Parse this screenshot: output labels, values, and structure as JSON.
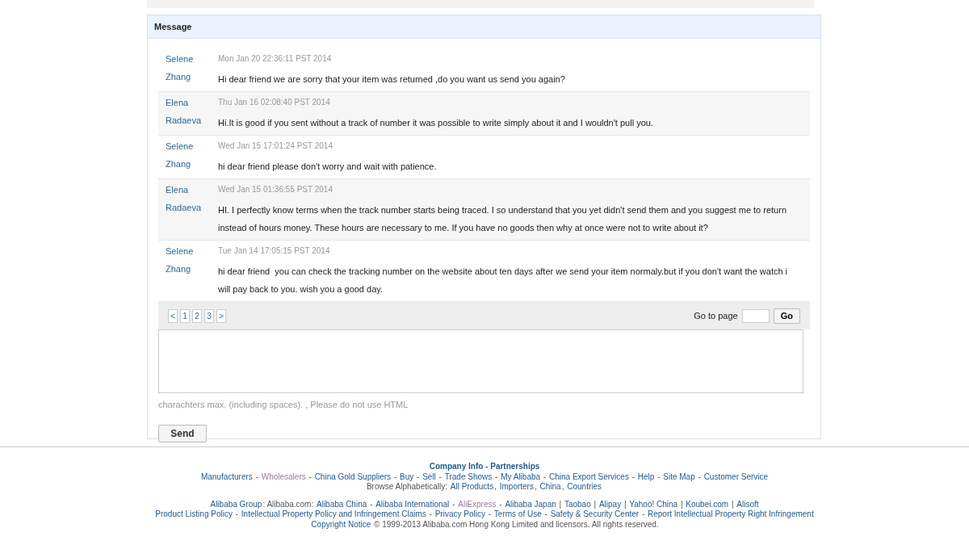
{
  "panel": {
    "title": "Message"
  },
  "messages": [
    {
      "sender": [
        "Selene",
        "Zhang"
      ],
      "time": "Mon Jan 20 22:36:11 PST 2014",
      "text": "Hi dear friend we are sorry that your item was returned ,do you want us send you again?"
    },
    {
      "sender": [
        "Elena",
        "Radaeva"
      ],
      "time": "Thu Jan 16 02:08:40 PST 2014",
      "text": "Hi.It is good if you sent without a track of number it was possible to write simply about it and I wouldn't pull you."
    },
    {
      "sender": [
        "Selene",
        "Zhang"
      ],
      "time": "Wed Jan 15 17:01:24 PST 2014",
      "text": "hi dear friend please don't worry and wait with patience."
    },
    {
      "sender": [
        "Elena",
        "Radaeva"
      ],
      "time": "Wed Jan 15 01:36:55 PST 2014",
      "text": "HI. I perfectly know terms when the track number starts being traced. I so understand that you yet didn't send them and you suggest me to return instead of hours money. These hours are necessary to me. If you have no goods then why at once were not to write about it?"
    },
    {
      "sender": [
        "Selene",
        "Zhang"
      ],
      "time": "Tue Jan 14 17:05:15 PST 2014",
      "text": "hi dear friend  you can check the tracking number on the website about ten days after we send your item normaly.but if you don't want the watch i will pay back to you. wish you a good day."
    }
  ],
  "pager": {
    "pages": [
      "<",
      "1",
      "2",
      "3",
      ">"
    ],
    "goto_label": "Go to page",
    "go_button": "Go"
  },
  "reply": {
    "hint": "charachters max. (including spaces). , Please do not use HTML",
    "send_button": "Send"
  },
  "footer": {
    "lines": [
      [
        {
          "kind": "heading",
          "text": "Company Info - Partnerships"
        }
      ],
      [
        {
          "kind": "link",
          "text": "Manufacturers",
          "visited": false
        },
        {
          "kind": "text",
          "text": " - "
        },
        {
          "kind": "link",
          "text": "Wholesalers",
          "visited": true
        },
        {
          "kind": "text",
          "text": " - "
        },
        {
          "kind": "link",
          "text": "China Gold Suppliers",
          "visited": false
        },
        {
          "kind": "text",
          "text": " - "
        },
        {
          "kind": "link",
          "text": "Buy",
          "visited": false
        },
        {
          "kind": "text",
          "text": " - "
        },
        {
          "kind": "link",
          "text": "Sell",
          "visited": false
        },
        {
          "kind": "text",
          "text": " - "
        },
        {
          "kind": "link",
          "text": "Trade Shows",
          "visited": false
        },
        {
          "kind": "text",
          "text": " - "
        },
        {
          "kind": "link",
          "text": "My Alibaba",
          "visited": false
        },
        {
          "kind": "text",
          "text": " - "
        },
        {
          "kind": "link",
          "text": "China Export Services",
          "visited": false
        },
        {
          "kind": "text",
          "text": " - "
        },
        {
          "kind": "link",
          "text": "Help",
          "visited": false
        },
        {
          "kind": "text",
          "text": " - "
        },
        {
          "kind": "link",
          "text": "Site Map",
          "visited": false
        },
        {
          "kind": "text",
          "text": " - "
        },
        {
          "kind": "link",
          "text": "Customer Service",
          "visited": false
        }
      ],
      [
        {
          "kind": "text",
          "text": "Browse Alphabetically: "
        },
        {
          "kind": "link",
          "text": "All Products",
          "visited": false
        },
        {
          "kind": "text",
          "text": ", "
        },
        {
          "kind": "link",
          "text": "Importers",
          "visited": false
        },
        {
          "kind": "text",
          "text": ", "
        },
        {
          "kind": "link",
          "text": "China",
          "visited": false
        },
        {
          "kind": "text",
          "text": ", "
        },
        {
          "kind": "link",
          "text": "Countries",
          "visited": false
        }
      ],
      [
        {
          "kind": "gap"
        }
      ],
      [
        {
          "kind": "link",
          "text": "Alibaba Group",
          "visited": false
        },
        {
          "kind": "text",
          "text": ": Alibaba.com: "
        },
        {
          "kind": "link",
          "text": "Alibaba China",
          "visited": false
        },
        {
          "kind": "text",
          "text": " - "
        },
        {
          "kind": "link",
          "text": "Alibaba International",
          "visited": false
        },
        {
          "kind": "text",
          "text": " - "
        },
        {
          "kind": "link",
          "text": "AliExpress",
          "visited": true
        },
        {
          "kind": "text",
          "text": " - "
        },
        {
          "kind": "link",
          "text": "Alibaba Japan",
          "visited": false
        },
        {
          "kind": "text",
          "text": " | "
        },
        {
          "kind": "link",
          "text": "Taobao",
          "visited": false
        },
        {
          "kind": "text",
          "text": " | "
        },
        {
          "kind": "link",
          "text": "Alipay",
          "visited": false
        },
        {
          "kind": "text",
          "text": " | "
        },
        {
          "kind": "link",
          "text": "Yahoo! China",
          "visited": false
        },
        {
          "kind": "text",
          "text": " | "
        },
        {
          "kind": "link",
          "text": "Koubei.com",
          "visited": false
        },
        {
          "kind": "text",
          "text": " | "
        },
        {
          "kind": "link",
          "text": "Alisoft",
          "visited": false
        }
      ],
      [
        {
          "kind": "link",
          "text": "Product Listing Policy",
          "visited": false
        },
        {
          "kind": "text",
          "text": " - "
        },
        {
          "kind": "link",
          "text": "Intellectual Property Policy and Infringement Claims",
          "visited": false
        },
        {
          "kind": "text",
          "text": " - "
        },
        {
          "kind": "link",
          "text": "Privacy Policy",
          "visited": false
        },
        {
          "kind": "text",
          "text": " - "
        },
        {
          "kind": "link",
          "text": "Terms of Use",
          "visited": false
        },
        {
          "kind": "text",
          "text": " - "
        },
        {
          "kind": "link",
          "text": "Safety & Security Center",
          "visited": false
        },
        {
          "kind": "text",
          "text": " - "
        },
        {
          "kind": "link",
          "text": "Report Intellectual Property Right Infringement",
          "visited": false
        }
      ],
      [
        {
          "kind": "link",
          "text": "Copyright Notice",
          "visited": false
        },
        {
          "kind": "text",
          "text": " © 1999-2013 Alibaba.com Hong Kong Limited and licensors. All rights reserved."
        }
      ]
    ]
  }
}
